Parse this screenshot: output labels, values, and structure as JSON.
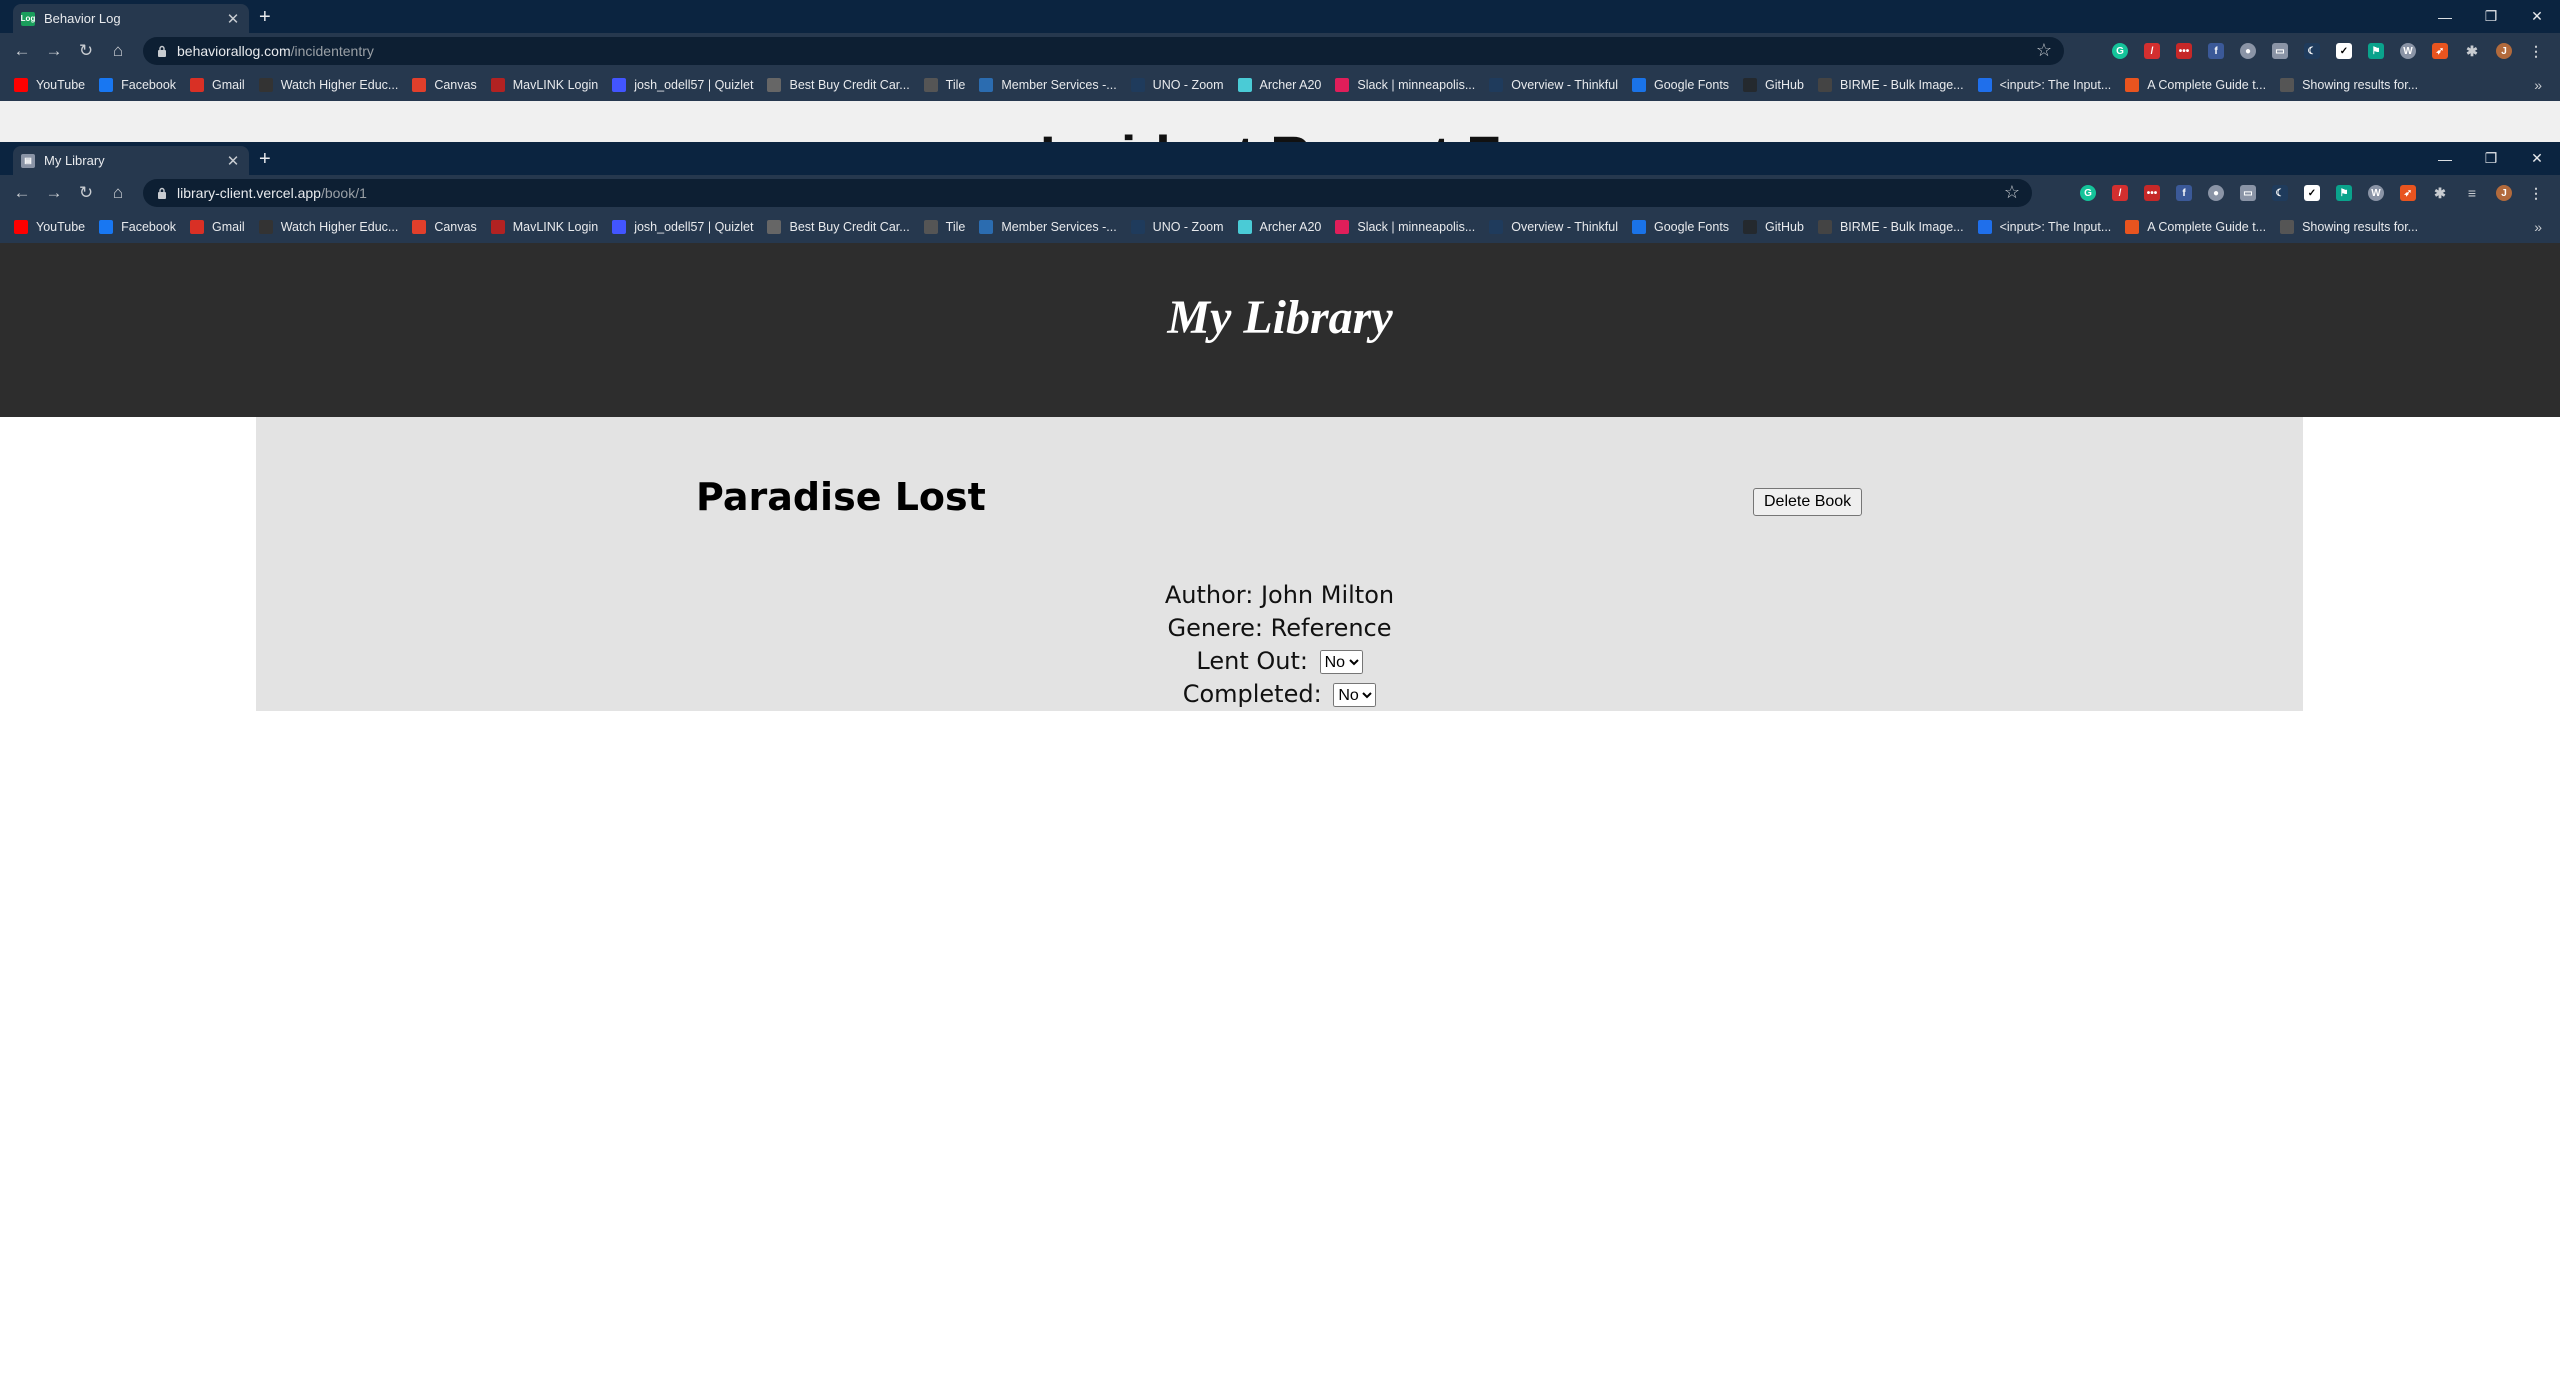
{
  "background_window": {
    "tab_title": "Behavior Log",
    "url_host": "behaviorallog.com",
    "url_path": "/incidententry"
  },
  "foreground_window": {
    "tab_title": "My Library",
    "url_host": "library-client.vercel.app",
    "url_path": "/book/1"
  },
  "bookmarks": [
    {
      "label": "YouTube",
      "icon": "youtube-icon",
      "color": "#ff0000"
    },
    {
      "label": "Facebook",
      "icon": "facebook-icon",
      "color": "#1877f2"
    },
    {
      "label": "Gmail",
      "icon": "gmail-icon",
      "color": "#d93025"
    },
    {
      "label": "Watch Higher Educ...",
      "icon": "kanopy-icon",
      "color": "#333333"
    },
    {
      "label": "Canvas",
      "icon": "canvas-icon",
      "color": "#e13f2b"
    },
    {
      "label": "MavLINK Login",
      "icon": "mavlink-icon",
      "color": "#b22222"
    },
    {
      "label": "josh_odell57 | Quizlet",
      "icon": "quizlet-icon",
      "color": "#4255ff"
    },
    {
      "label": "Best Buy Credit Car...",
      "icon": "citi-icon",
      "color": "#666666"
    },
    {
      "label": "Tile",
      "icon": "tile-icon",
      "color": "#555555"
    },
    {
      "label": "Member Services -...",
      "icon": "member-services-icon",
      "color": "#2b6cb0"
    },
    {
      "label": "UNO - Zoom",
      "icon": "zoom-icon",
      "color": "#1f3b5c"
    },
    {
      "label": "Archer A20",
      "icon": "tplink-icon",
      "color": "#4acbd6"
    },
    {
      "label": "Slack | minneapolis...",
      "icon": "slack-icon",
      "color": "#e01e5a"
    },
    {
      "label": "Overview - Thinkful",
      "icon": "thinkful-icon",
      "color": "#1f3b5c"
    },
    {
      "label": "Google Fonts",
      "icon": "google-fonts-icon",
      "color": "#1a73e8"
    },
    {
      "label": "GitHub",
      "icon": "github-icon",
      "color": "#24292e"
    },
    {
      "label": "BIRME - Bulk Image...",
      "icon": "birme-icon",
      "color": "#444444"
    },
    {
      "label": "<input>: The Input...",
      "icon": "mdn-icon",
      "color": "#1f6feb"
    },
    {
      "label": "A Complete Guide t...",
      "icon": "css-tricks-icon",
      "color": "#e8541f"
    },
    {
      "label": "Showing results for...",
      "icon": "nu-icon",
      "color": "#555555"
    }
  ],
  "background_heading_fragment": "Incident Report Form",
  "site": {
    "title": "My Library"
  },
  "book": {
    "title": "Paradise Lost",
    "delete_label": "Delete Book",
    "author_label": "Author: John Milton",
    "genre_label": "Genere: Reference",
    "lent_out_label": "Lent Out:",
    "lent_out_value": "No",
    "completed_label": "Completed:",
    "completed_value": "No"
  }
}
